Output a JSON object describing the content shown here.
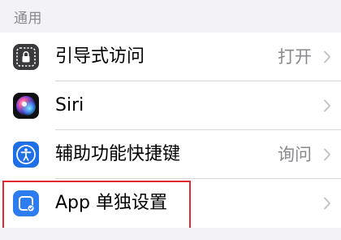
{
  "section": {
    "header": "通用"
  },
  "rows": [
    {
      "label": "引导式访问",
      "value": "打开",
      "icon": "guided-access-icon",
      "icon_bg": "#3c3c3e"
    },
    {
      "label": "Siri",
      "value": "",
      "icon": "siri-icon",
      "icon_bg": "#1c1c1e"
    },
    {
      "label": "辅助功能快捷键",
      "value": "询问",
      "icon": "accessibility-icon",
      "icon_bg": "#1f6fe6"
    },
    {
      "label": "App 单独设置",
      "value": "",
      "icon": "per-app-settings-icon",
      "icon_bg": "#2d7cf0"
    }
  ],
  "colors": {
    "highlight_border": "#e12b2f",
    "secondary_text": "#8a8a8e",
    "background": "#f2f2f7"
  }
}
